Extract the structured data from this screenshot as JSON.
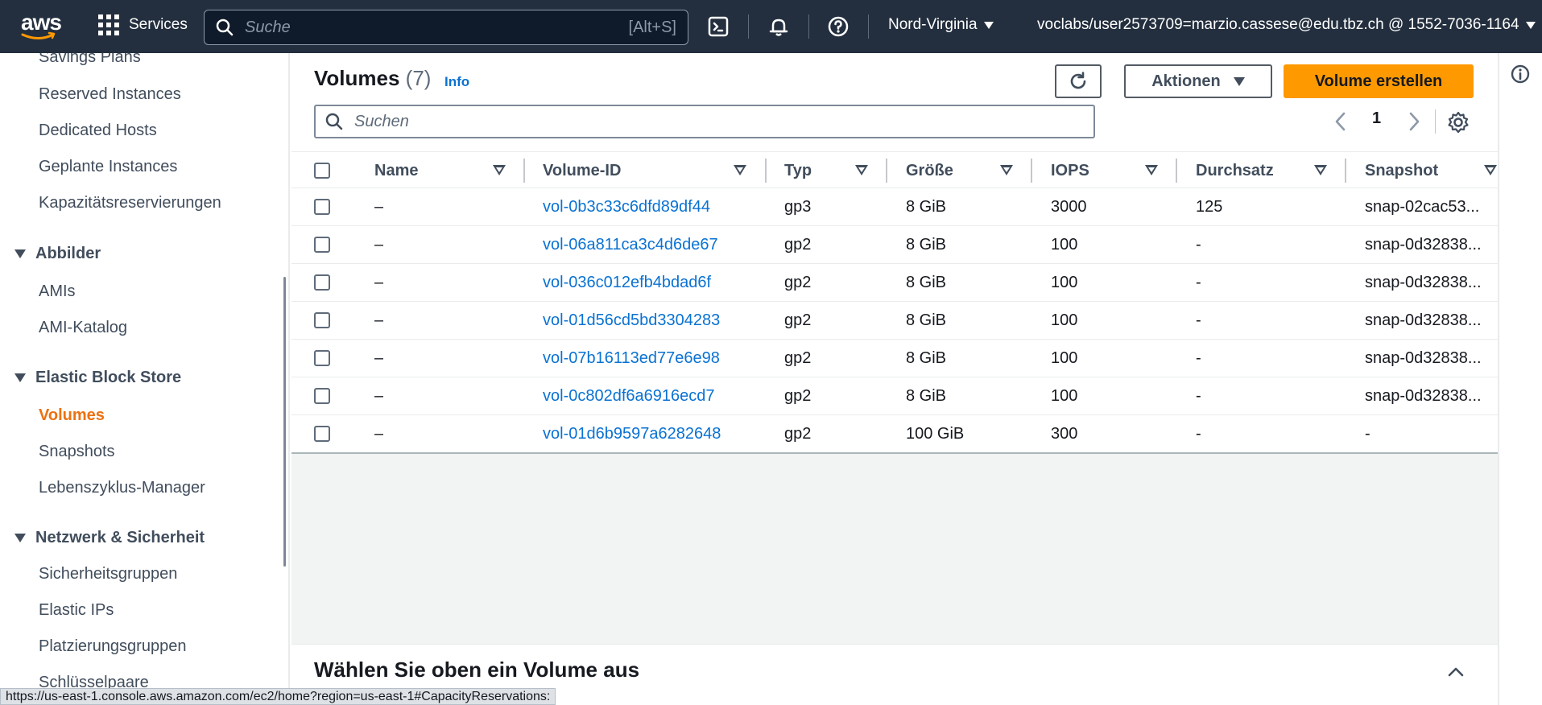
{
  "topnav": {
    "logo": "aws",
    "services_label": "Services",
    "search_placeholder": "Suche",
    "search_shortcut": "[Alt+S]",
    "icons": [
      "cloudshell-icon",
      "bell-icon",
      "help-icon"
    ],
    "region": "Nord-Virginia",
    "account": "voclabs/user2573709=marzio.cassese@edu.tbz.ch @ 1552-7036-1164"
  },
  "sidebar": {
    "items_top": [
      "Savings Plans",
      "Reserved Instances",
      "Dedicated Hosts",
      "Geplante Instances",
      "Kapazitätsreservierungen"
    ],
    "section_images": "Abbilder",
    "items_images": [
      "AMIs",
      "AMI-Katalog"
    ],
    "section_ebs": "Elastic Block Store",
    "items_ebs": [
      "Volumes",
      "Snapshots",
      "Lebenszyklus-Manager"
    ],
    "section_network": "Netzwerk & Sicherheit",
    "items_network": [
      "Sicherheitsgruppen",
      "Elastic IPs",
      "Platzierungsgruppen",
      "Schlüsselpaare"
    ],
    "active_item": "Volumes"
  },
  "volumes": {
    "title": "Volumes",
    "count": "(7)",
    "info_label": "Info",
    "actions_label": "Aktionen",
    "create_label": "Volume erstellen",
    "search_placeholder": "Suchen",
    "page": "1",
    "columns": [
      "Name",
      "Volume-ID",
      "Typ",
      "Größe",
      "IOPS",
      "Durchsatz",
      "Snapshot"
    ],
    "rows": [
      {
        "name": "–",
        "id": "vol-0b3c33c6dfd89df44",
        "type": "gp3",
        "size": "8 GiB",
        "iops": "3000",
        "throughput": "125",
        "snapshot": "snap-02cac53..."
      },
      {
        "name": "–",
        "id": "vol-06a811ca3c4d6de67",
        "type": "gp2",
        "size": "8 GiB",
        "iops": "100",
        "throughput": "-",
        "snapshot": "snap-0d32838..."
      },
      {
        "name": "–",
        "id": "vol-036c012efb4bdad6f",
        "type": "gp2",
        "size": "8 GiB",
        "iops": "100",
        "throughput": "-",
        "snapshot": "snap-0d32838..."
      },
      {
        "name": "–",
        "id": "vol-01d56cd5bd3304283",
        "type": "gp2",
        "size": "8 GiB",
        "iops": "100",
        "throughput": "-",
        "snapshot": "snap-0d32838..."
      },
      {
        "name": "–",
        "id": "vol-07b16113ed77e6e98",
        "type": "gp2",
        "size": "8 GiB",
        "iops": "100",
        "throughput": "-",
        "snapshot": "snap-0d32838..."
      },
      {
        "name": "–",
        "id": "vol-0c802df6a6916ecd7",
        "type": "gp2",
        "size": "8 GiB",
        "iops": "100",
        "throughput": "-",
        "snapshot": "snap-0d32838..."
      },
      {
        "name": "–",
        "id": "vol-01d6b9597a6282648",
        "type": "gp2",
        "size": "100 GiB",
        "iops": "300",
        "throughput": "-",
        "snapshot": "-"
      }
    ]
  },
  "details": {
    "title": "Wählen Sie oben ein Volume aus"
  },
  "statusbar": {
    "url": "https://us-east-1.console.aws.amazon.com/ec2/home?region=us-east-1#CapacityReservations:"
  },
  "colors": {
    "nav_bg": "#232f3e",
    "primary_button": "#ff9900",
    "link": "#0972d3",
    "active_nav": "#ec7211"
  }
}
